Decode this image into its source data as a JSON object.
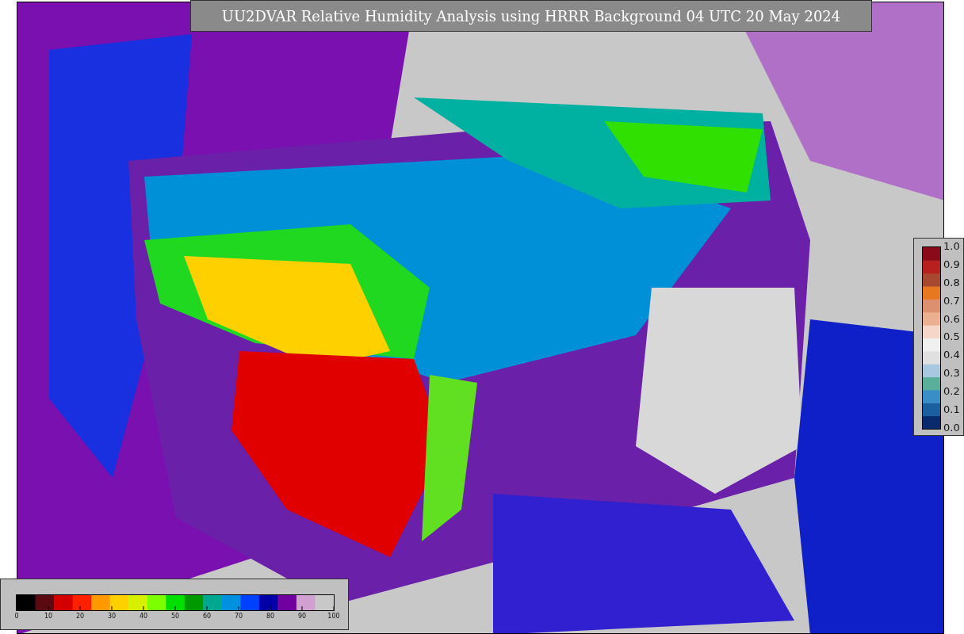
{
  "title": "UU2DVAR Relative Humidity Analysis using HRRR Background 04 UTC 20 May 2024",
  "humidity_scale": {
    "ticks": [
      "0",
      "10",
      "20",
      "30",
      "40",
      "50",
      "60",
      "70",
      "80",
      "90",
      "100"
    ]
  },
  "station_scale": {
    "ticks": [
      "1.0",
      "0.9",
      "0.8",
      "0.7",
      "0.6",
      "0.5",
      "0.4",
      "0.3",
      "0.2",
      "0.1",
      "0.0"
    ]
  }
}
